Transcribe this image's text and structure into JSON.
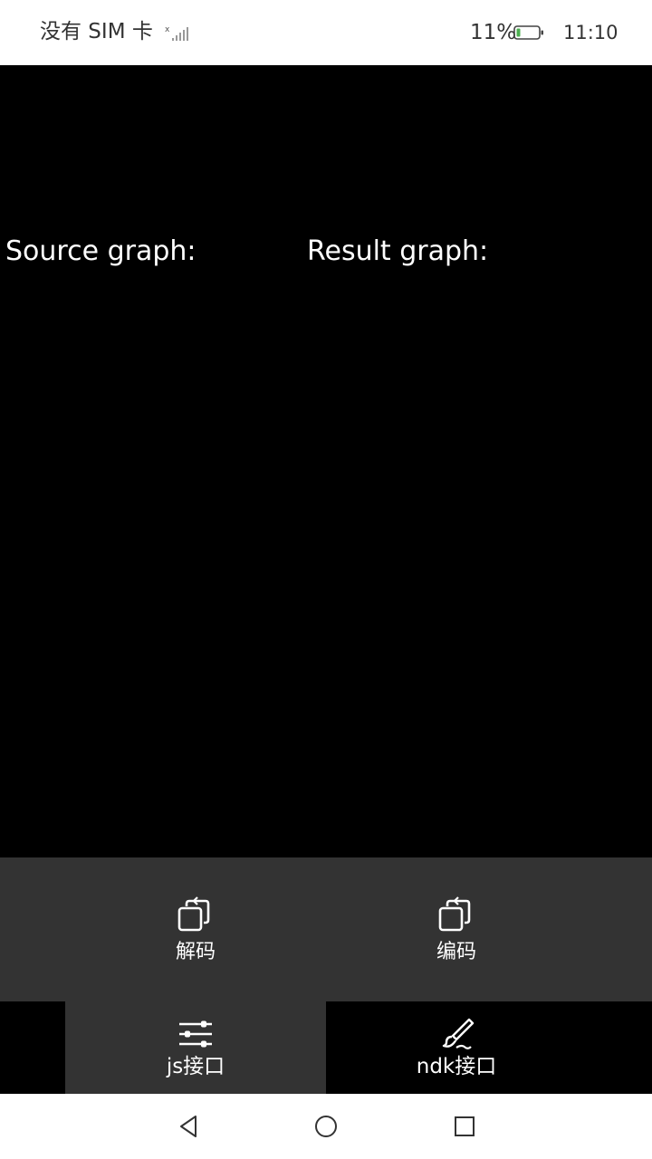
{
  "status_bar": {
    "carrier": "没有 SIM 卡",
    "battery_percent": "11%",
    "time": "11:10",
    "icons": [
      "signal-icon",
      "battery-icon"
    ]
  },
  "content": {
    "source_label": "Source graph:",
    "result_label": "Result graph:"
  },
  "actions": [
    {
      "label": "解码",
      "icon": "rotate-copy-icon"
    },
    {
      "label": "编码",
      "icon": "rotate-copy-icon"
    }
  ],
  "tabs": [
    {
      "label": "js接口",
      "icon": "sliders-icon",
      "active": true
    },
    {
      "label": "ndk接口",
      "icon": "brush-icon",
      "active": false
    }
  ],
  "nav": {
    "icons": [
      "back-icon",
      "home-icon",
      "recent-apps-icon"
    ]
  },
  "colors": {
    "background": "#000000",
    "panel": "#333333",
    "battery_accent": "#4caf50"
  }
}
